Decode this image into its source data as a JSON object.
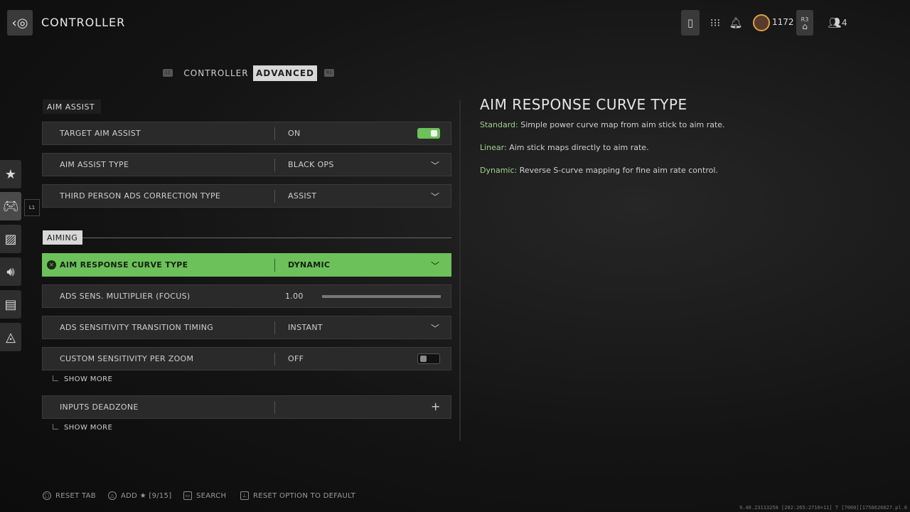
{
  "header": {
    "title": "CONTROLLER",
    "points": "1172",
    "party_count": "4",
    "r3_label": "R3"
  },
  "tabs": {
    "l1": "L1",
    "r1": "R1",
    "items": [
      {
        "label": "CONTROLLER",
        "active": false
      },
      {
        "label": "ADVANCED",
        "active": true
      }
    ]
  },
  "sidebar": {
    "l1_hint": "L1",
    "items": [
      "star-icon",
      "controller-icon",
      "display-icon",
      "audio-icon",
      "interface-icon",
      "account-network-icon"
    ]
  },
  "sections": {
    "aim_assist": "AIM ASSIST",
    "aiming": "AIMING"
  },
  "rows": {
    "target_aim_assist": {
      "label": "TARGET AIM ASSIST",
      "value": "ON"
    },
    "aim_assist_type": {
      "label": "AIM ASSIST TYPE",
      "value": "BLACK OPS"
    },
    "third_person_ads": {
      "label": "THIRD PERSON ADS CORRECTION TYPE",
      "value": "ASSIST"
    },
    "aim_response_curve": {
      "label": "AIM RESPONSE CURVE TYPE",
      "value": "DYNAMIC"
    },
    "ads_sens_multiplier": {
      "label": "ADS SENS. MULTIPLIER (FOCUS)",
      "value": "1.00",
      "slider_fraction": 0.0
    },
    "ads_transition_timing": {
      "label": "ADS SENSITIVITY TRANSITION TIMING",
      "value": "INSTANT"
    },
    "custom_sens_per_zoom": {
      "label": "CUSTOM SENSITIVITY PER ZOOM",
      "value": "OFF"
    },
    "show_more_1": "SHOW MORE",
    "inputs_deadzone": {
      "label": "INPUTS DEADZONE",
      "value": ""
    },
    "show_more_2": "SHOW MORE"
  },
  "detail": {
    "title": "AIM RESPONSE CURVE TYPE",
    "lines": [
      {
        "key": "Standard:",
        "text": " Simple power curve map from aim stick to aim rate."
      },
      {
        "key": "Linear:",
        "text": " Aim stick maps directly to aim rate."
      },
      {
        "key": "Dynamic:",
        "text": " Reverse S-curve mapping for fine aim rate control."
      }
    ]
  },
  "footer": {
    "reset_tab": "RESET TAB",
    "add_favorite": "ADD ★ [9/15]",
    "search": "SEARCH",
    "reset_option": "RESET OPTION TO DEFAULT",
    "build": "9.40.23113258 [202:265:2710+11] T [7000][1756626827.pl.0.ps5]"
  },
  "colors": {
    "accent": "#6cc15a",
    "active_tab_bg": "#d8d8d8",
    "row_bg": "#2a2a2a"
  }
}
